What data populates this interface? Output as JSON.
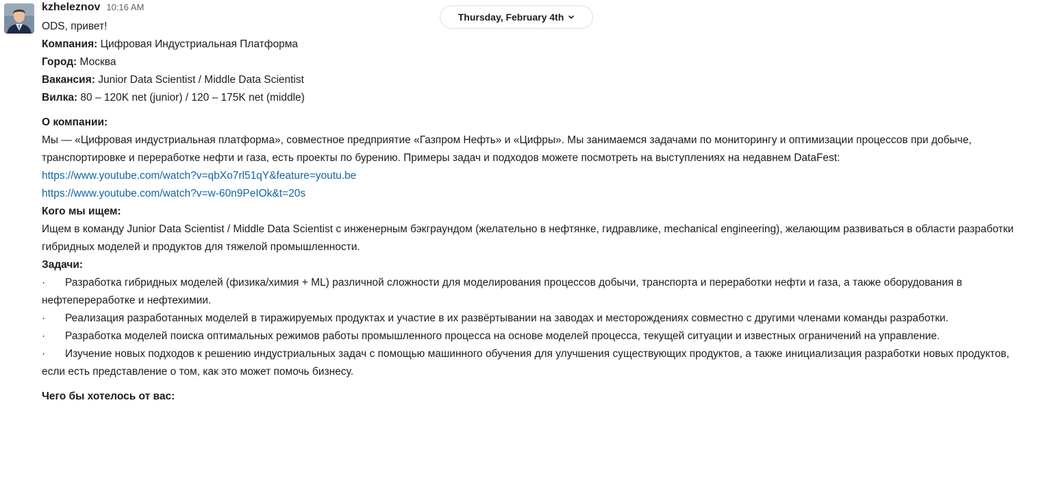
{
  "message": {
    "author": "kzheleznov",
    "time": "10:16 AM",
    "greeting": "ODS, привет!",
    "fields": [
      {
        "label": "Компания:",
        "value": " Цифровая Индустриальная Платформа"
      },
      {
        "label": "Город:",
        "value": " Москва"
      },
      {
        "label": "Вакансия:",
        "value": " Junior Data Scientist / Middle Data Scientist"
      },
      {
        "label": "Вилка:",
        "value": " 80 – 120K net (junior) / 120 – 175K net (middle)"
      }
    ],
    "about_heading": "О компании:",
    "about_text": "Мы — «Цифровая индустриальная платформа», совместное предприятие «Газпром Нефть» и «Цифры». Мы занимаемся задачами по мониторингу и оптимизации процессов при добыче, транспортировке и переработке нефти и газа, есть проекты по бурению. Примеры задач и подходов можете посмотреть на выступлениях на недавнем DataFest:",
    "links": [
      "https://www.youtube.com/watch?v=qbXo7rl51qY&feature=youtu.be",
      "https://www.youtube.com/watch?v=w-60n9PeIOk&t=20s"
    ],
    "seeking_heading": "Кого мы ищем:",
    "seeking_text": "Ищем в команду Junior Data Scientist / Middle Data Scientist с инженерным бэкграундом (желательно в нефтянке, гидравлике, mechanical engineering), желающим развиваться в области разработки гибридных моделей и продуктов для тяжелой промышленности.",
    "tasks_heading": "Задачи:",
    "bullet_char": "·",
    "tasks": [
      "Разработка гибридных моделей (физика/химия + ML) различной сложности для моделирования процессов добычи, транспорта и переработки нефти и газа, а также оборудования в нефтепереработке и нефтехимии.",
      "Реализация разработанных моделей в тиражируемых продуктах и участие в их развёртывании на заводах и месторождениях совместно с другими членами команды разработки.",
      "Разработка моделей поиска оптимальных режимов работы промышленного процесса на основе моделей процесса, текущей ситуации и известных ограничений на управление.",
      "Изучение новых подходов к решению индустриальных задач с помощью машинного обучения для улучшения существующих продуктов, а также инициализация разработки новых продуктов, если есть представление о том, как это может помочь бизнесу."
    ],
    "wishes_heading": "Чего бы хотелось от вас:"
  },
  "date_divider": {
    "label": "Thursday, February 4th",
    "icon": "chevron-down-icon"
  },
  "colors": {
    "text": "#1d1c1d",
    "muted": "#616061",
    "link": "#1264a3",
    "border": "#dddddd"
  }
}
